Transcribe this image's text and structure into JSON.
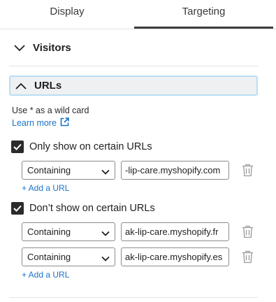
{
  "tabs": [
    {
      "label": "Display",
      "active": false
    },
    {
      "label": "Targeting",
      "active": true
    }
  ],
  "visitors": {
    "label": "Visitors",
    "expanded": false
  },
  "urls": {
    "label": "URLs",
    "expanded": true,
    "hint": "Use * as a wild card",
    "learn_more": "Learn more",
    "only_show": {
      "label": "Only show on certain URLs",
      "checked": true,
      "rules": [
        {
          "match": "Containing",
          "value": "-lip-care.myshopify.com"
        }
      ],
      "add_label": "+ Add a URL"
    },
    "dont_show": {
      "label": "Don’t show on certain URLs",
      "checked": true,
      "rules": [
        {
          "match": "Containing",
          "value": "ak-lip-care.myshopify.fr"
        },
        {
          "match": "Containing",
          "value": "ak-lip-care.myshopify.es"
        }
      ],
      "add_label": "+ Add a URL"
    }
  },
  "colors": {
    "link": "#1a73c8",
    "focus_border": "#b8dff5",
    "checkbox": "#2b2b2b"
  },
  "icons": [
    "chevron-down-icon",
    "chevron-up-icon",
    "external-link-icon",
    "checkmark-icon",
    "dropdown-arrow-icon",
    "trash-icon"
  ]
}
